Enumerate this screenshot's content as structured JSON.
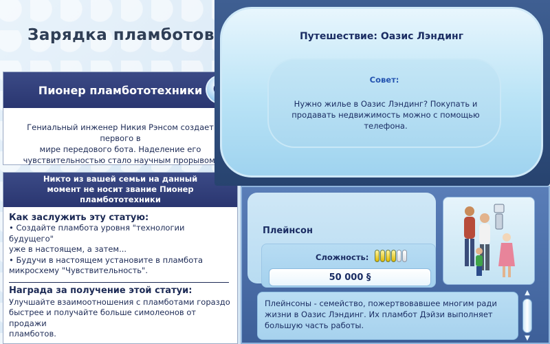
{
  "loading": {
    "title": "Зарядка пламботов..."
  },
  "achievement": {
    "title": "Пионер пламбототехники",
    "description_lines": [
      "Гениальный инженер Никия Рэнсом создает первого в",
      "мире передового бота. Наделение его",
      "чувствительностью стало научным прорывом."
    ],
    "icon": "magnifier-icon"
  },
  "howto": {
    "status_lines": [
      "Никто из вашей семьи на данный",
      "момент не носит звание Пионер",
      "пламбототехники"
    ],
    "earn_title": "Как заслужить эту статую:",
    "bullet1_lines": [
      "• Создайте пламбота уровня \"технологии будущего\"",
      "уже в настоящем, а затем..."
    ],
    "bullet2_lines": [
      "• Будучи в настоящем установите в пламбота",
      "микросхему \"Чувствительность\"."
    ],
    "reward_title": "Награда за получение этой статуи:",
    "reward_lines": [
      "Улучшайте взаимоотношения с пламботами гораздо",
      "быстрее и получайте больше симолеонов от продажи",
      "пламботов."
    ]
  },
  "tip": {
    "title": "Путешествие: Оазис Лэндинг",
    "label": "Совет:",
    "text_lines": [
      "Нужно жилье в Оазис Лэндинг? Покупать и",
      "продавать недвижимость можно с помощью",
      "телефона."
    ]
  },
  "family": {
    "name": "Плейнсон",
    "difficulty_label": "Сложность:",
    "difficulty": {
      "filled": 4,
      "total": 6
    },
    "funds": "50 000 §",
    "description_lines": [
      "Плейнсоны - семейство, пожертвовавшее многим ради",
      "жизни в Оазис Лэндинг. Их пламбот Дэйзи выполняет",
      "большую часть работы."
    ]
  },
  "colors": {
    "header_navy": "#2a3670",
    "text_navy": "#1b2d63",
    "tip_label_blue": "#2454b0",
    "pip_gold": "#e0b800"
  }
}
